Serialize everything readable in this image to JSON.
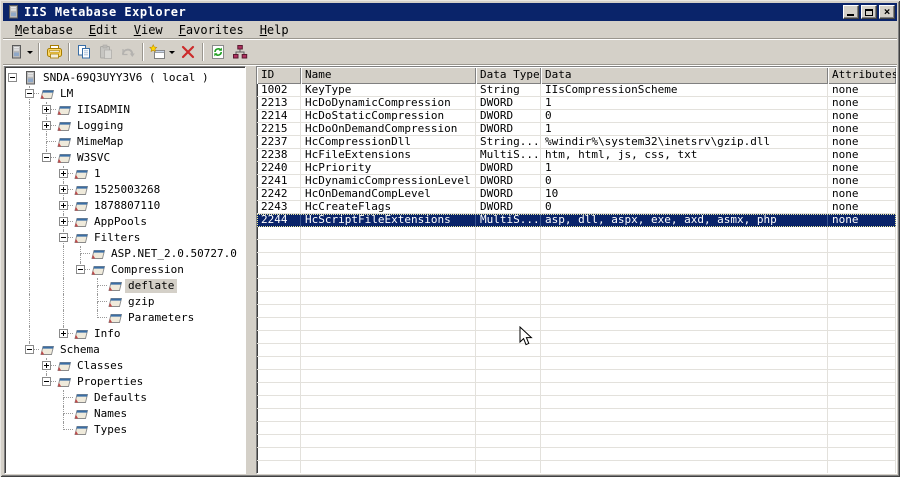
{
  "window": {
    "title": "IIS Metabase Explorer"
  },
  "menu": {
    "items": [
      {
        "label": "Metabase",
        "underline": 0
      },
      {
        "label": "Edit",
        "underline": 0
      },
      {
        "label": "View",
        "underline": 0
      },
      {
        "label": "Favorites",
        "underline": 0
      },
      {
        "label": "Help",
        "underline": 0
      }
    ]
  },
  "toolbar": {
    "buttons": [
      {
        "name": "connect-server-button",
        "icon": "server-icon",
        "dropdown": true,
        "enabled": true
      },
      {
        "sep": true
      },
      {
        "name": "print-button",
        "icon": "printer-icon",
        "enabled": true
      },
      {
        "sep": true
      },
      {
        "name": "copy-button",
        "icon": "copy-icon",
        "enabled": true
      },
      {
        "name": "paste-button",
        "icon": "paste-icon",
        "enabled": false
      },
      {
        "name": "undo-button",
        "icon": "undo-icon",
        "enabled": false
      },
      {
        "sep": true
      },
      {
        "name": "new-key-button",
        "icon": "new-key-icon",
        "dropdown": true,
        "enabled": true
      },
      {
        "name": "delete-button",
        "icon": "delete-icon",
        "enabled": true
      },
      {
        "sep": true
      },
      {
        "name": "refresh-button",
        "icon": "refresh-icon",
        "enabled": true
      },
      {
        "name": "hierarchy-button",
        "icon": "hierarchy-icon",
        "enabled": true
      }
    ]
  },
  "tree": {
    "items": [
      {
        "label": "SNDA-69Q3UYY3V6 ( local )",
        "level": 0,
        "expander": "minus",
        "icon": "computer-icon",
        "selected": false
      },
      {
        "label": "LM",
        "level": 1,
        "expander": "minus",
        "icon": "key-icon",
        "selected": false
      },
      {
        "label": "IISADMIN",
        "level": 2,
        "expander": "plus",
        "icon": "key-icon",
        "selected": false
      },
      {
        "label": "Logging",
        "level": 2,
        "expander": "plus",
        "icon": "key-icon",
        "selected": false
      },
      {
        "label": "MimeMap",
        "level": 2,
        "expander": "none",
        "icon": "key-icon",
        "selected": false
      },
      {
        "label": "W3SVC",
        "level": 2,
        "expander": "minus",
        "icon": "key-icon",
        "selected": false
      },
      {
        "label": "1",
        "level": 3,
        "expander": "plus",
        "icon": "key-icon",
        "selected": false
      },
      {
        "label": "1525003268",
        "level": 3,
        "expander": "plus",
        "icon": "key-icon",
        "selected": false
      },
      {
        "label": "1878807110",
        "level": 3,
        "expander": "plus",
        "icon": "key-icon",
        "selected": false
      },
      {
        "label": "AppPools",
        "level": 3,
        "expander": "plus",
        "icon": "key-icon",
        "selected": false
      },
      {
        "label": "Filters",
        "level": 3,
        "expander": "minus",
        "icon": "key-icon",
        "selected": false
      },
      {
        "label": "ASP.NET_2.0.50727.0",
        "level": 4,
        "expander": "none",
        "icon": "key-icon",
        "selected": false
      },
      {
        "label": "Compression",
        "level": 4,
        "expander": "minus",
        "icon": "key-icon",
        "selected": false
      },
      {
        "label": "deflate",
        "level": 5,
        "expander": "none",
        "icon": "key-icon",
        "selected": true
      },
      {
        "label": "gzip",
        "level": 5,
        "expander": "none",
        "icon": "key-icon",
        "selected": false
      },
      {
        "label": "Parameters",
        "level": 5,
        "expander": "none",
        "icon": "key-icon",
        "selected": false
      },
      {
        "label": "Info",
        "level": 3,
        "expander": "plus",
        "icon": "key-icon",
        "selected": false
      },
      {
        "label": "Schema",
        "level": 1,
        "expander": "minus",
        "icon": "key-icon",
        "selected": false
      },
      {
        "label": "Classes",
        "level": 2,
        "expander": "plus",
        "icon": "key-icon",
        "selected": false
      },
      {
        "label": "Properties",
        "level": 2,
        "expander": "minus",
        "icon": "key-icon",
        "selected": false
      },
      {
        "label": "Defaults",
        "level": 3,
        "expander": "none",
        "icon": "key-icon",
        "selected": false
      },
      {
        "label": "Names",
        "level": 3,
        "expander": "none",
        "icon": "key-icon",
        "selected": false
      },
      {
        "label": "Types",
        "level": 3,
        "expander": "none",
        "icon": "key-icon",
        "selected": false
      }
    ]
  },
  "table": {
    "columns": [
      "ID",
      "Name",
      "Data Type",
      "Data",
      "Attributes"
    ],
    "rows": [
      {
        "cells": [
          "1002",
          "KeyType",
          "String",
          "IIsCompressionScheme",
          "none"
        ],
        "selected": false
      },
      {
        "cells": [
          "2213",
          "HcDoDynamicCompression",
          "DWORD",
          "1",
          "none"
        ],
        "selected": false
      },
      {
        "cells": [
          "2214",
          "HcDoStaticCompression",
          "DWORD",
          "0",
          "none"
        ],
        "selected": false
      },
      {
        "cells": [
          "2215",
          "HcDoOnDemandCompression",
          "DWORD",
          "1",
          "none"
        ],
        "selected": false
      },
      {
        "cells": [
          "2237",
          "HcCompressionDll",
          "String...",
          "%windir%\\system32\\inetsrv\\gzip.dll",
          "none"
        ],
        "selected": false
      },
      {
        "cells": [
          "2238",
          "HcFileExtensions",
          "MultiS...",
          "htm, html, js, css, txt",
          "none"
        ],
        "selected": false
      },
      {
        "cells": [
          "2240",
          "HcPriority",
          "DWORD",
          "1",
          "none"
        ],
        "selected": false
      },
      {
        "cells": [
          "2241",
          "HcDynamicCompressionLevel",
          "DWORD",
          "0",
          "none"
        ],
        "selected": false
      },
      {
        "cells": [
          "2242",
          "HcOnDemandCompLevel",
          "DWORD",
          "10",
          "none"
        ],
        "selected": false
      },
      {
        "cells": [
          "2243",
          "HcCreateFlags",
          "DWORD",
          "0",
          "none"
        ],
        "selected": false
      },
      {
        "cells": [
          "2244",
          "HcScriptFileExtensions",
          "MultiS...",
          "asp, dll, aspx, exe, axd, asmx, php",
          "none"
        ],
        "selected": true
      }
    ],
    "empty_filler_rows": 19
  },
  "colors": {
    "titlebar": "#0A246A",
    "chrome": "#D4D0C8",
    "selection": "#0A246A",
    "gridline": "#e3e1dc",
    "tree_inactive_selection": "#D4D0C8"
  }
}
